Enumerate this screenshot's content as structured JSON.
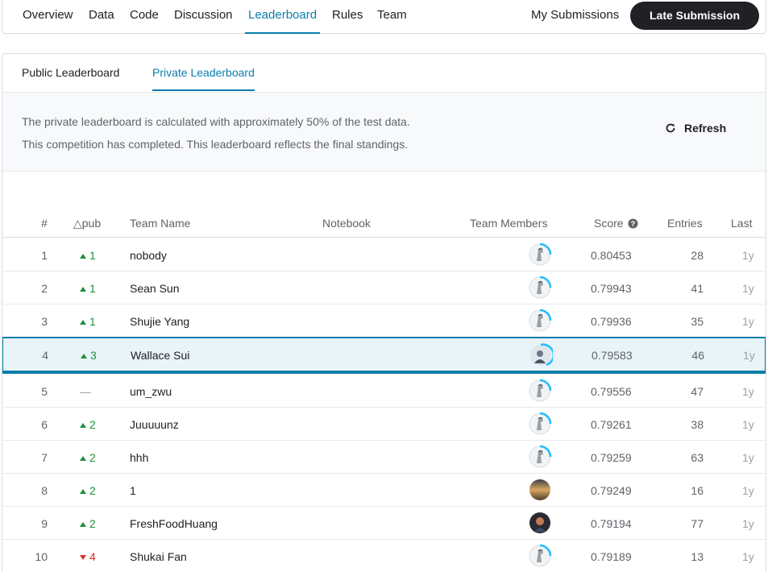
{
  "nav": {
    "tabs": [
      {
        "label": "Overview"
      },
      {
        "label": "Data"
      },
      {
        "label": "Code"
      },
      {
        "label": "Discussion"
      },
      {
        "label": "Leaderboard",
        "active": true
      },
      {
        "label": "Rules"
      },
      {
        "label": "Team"
      }
    ],
    "my_submissions": "My Submissions",
    "late_submission": "Late Submission"
  },
  "leaderboard": {
    "tabs": [
      {
        "label": "Public Leaderboard"
      },
      {
        "label": "Private Leaderboard",
        "active": true
      }
    ],
    "info_line1": "The private leaderboard is calculated with approximately 50% of the test data.",
    "info_line2": "This competition has completed. This leaderboard reflects the final standings.",
    "refresh_label": "Refresh",
    "columns": {
      "rank": "#",
      "delta": "△pub",
      "team_name": "Team Name",
      "notebook": "Notebook",
      "team_members": "Team Members",
      "score": "Score",
      "entries": "Entries",
      "last": "Last"
    },
    "rows": [
      {
        "rank": "1",
        "delta": "1",
        "dir": "up",
        "team": "nobody",
        "score": "0.80453",
        "entries": "28",
        "last": "1y",
        "avatar": "default"
      },
      {
        "rank": "2",
        "delta": "1",
        "dir": "up",
        "team": "Sean Sun",
        "score": "0.79943",
        "entries": "41",
        "last": "1y",
        "avatar": "default"
      },
      {
        "rank": "3",
        "delta": "1",
        "dir": "up",
        "team": "Shujie Yang",
        "score": "0.79936",
        "entries": "35",
        "last": "1y",
        "avatar": "default"
      },
      {
        "rank": "4",
        "delta": "3",
        "dir": "up",
        "team": "Wallace Sui",
        "score": "0.79583",
        "entries": "46",
        "last": "1y",
        "avatar": "photo-blue",
        "highlight": true
      },
      {
        "rank": "5",
        "delta": "—",
        "dir": "none",
        "team": "um_zwu",
        "score": "0.79556",
        "entries": "47",
        "last": "1y",
        "avatar": "default"
      },
      {
        "rank": "6",
        "delta": "2",
        "dir": "up",
        "team": "Juuuuunz",
        "score": "0.79261",
        "entries": "38",
        "last": "1y",
        "avatar": "default"
      },
      {
        "rank": "7",
        "delta": "2",
        "dir": "up",
        "team": "hhh",
        "score": "0.79259",
        "entries": "63",
        "last": "1y",
        "avatar": "default"
      },
      {
        "rank": "8",
        "delta": "2",
        "dir": "up",
        "team": "1",
        "score": "0.79249",
        "entries": "16",
        "last": "1y",
        "avatar": "photo-sunset"
      },
      {
        "rank": "9",
        "delta": "2",
        "dir": "up",
        "team": "FreshFoodHuang",
        "score": "0.79194",
        "entries": "77",
        "last": "1y",
        "avatar": "photo-dark"
      },
      {
        "rank": "10",
        "delta": "4",
        "dir": "down",
        "team": "Shukai Fan",
        "score": "0.79189",
        "entries": "13",
        "last": "1y",
        "avatar": "default"
      }
    ]
  },
  "colors": {
    "accent": "#0b7dab",
    "up": "#1e8e3e",
    "down": "#d93025",
    "button_bg": "#202124"
  },
  "icons": {
    "refresh": "refresh-icon",
    "help": "help-circle-icon",
    "up": "triangle-up-icon",
    "down": "triangle-down-icon"
  }
}
